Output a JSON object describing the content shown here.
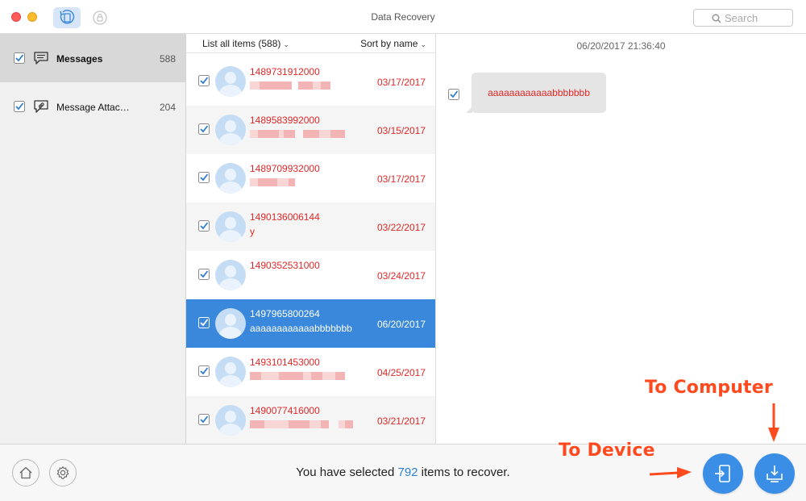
{
  "window": {
    "title": "Data Recovery",
    "search_placeholder": "Search"
  },
  "sidebar": {
    "items": [
      {
        "label": "Messages",
        "count": "588",
        "icon": "chat-bubble-icon",
        "active": true
      },
      {
        "label": "Message Attac…",
        "count": "204",
        "icon": "paperclip-bubble-icon",
        "active": false
      }
    ]
  },
  "list": {
    "filter_label": "List all items (588)",
    "sort_label": "Sort by name",
    "rows": [
      {
        "number": "1489731912000",
        "preview": "",
        "date": "03/17/2017",
        "selected": false
      },
      {
        "number": "1489583992000",
        "preview": "",
        "date": "03/15/2017",
        "selected": false
      },
      {
        "number": "1489709932000",
        "preview": "",
        "date": "03/17/2017",
        "selected": false
      },
      {
        "number": "1490136006144",
        "preview": "y",
        "date": "03/22/2017",
        "selected": false
      },
      {
        "number": "1490352531000",
        "preview": "",
        "date": "03/24/2017",
        "selected": false
      },
      {
        "number": "1497965800264",
        "preview": "aaaaaaaaaaaabbbbbbb",
        "date": "06/20/2017",
        "selected": true
      },
      {
        "number": "1493101453000",
        "preview": "",
        "date": "04/25/2017",
        "selected": false
      },
      {
        "number": "1490077416000",
        "preview": "",
        "date": "03/21/2017",
        "selected": false
      }
    ]
  },
  "detail": {
    "timestamp": "06/20/2017 21:36:40",
    "message": "aaaaaaaaaaaabbbbbbb"
  },
  "footer": {
    "text_before": "You have selected ",
    "selected_count": "792",
    "text_after": " items to recover."
  },
  "annotations": {
    "to_computer": "To Computer",
    "to_device": "To Device"
  },
  "colors": {
    "accent": "#3a88dc",
    "highlight_text": "#e02828",
    "annotation": "#ff4a1f"
  }
}
